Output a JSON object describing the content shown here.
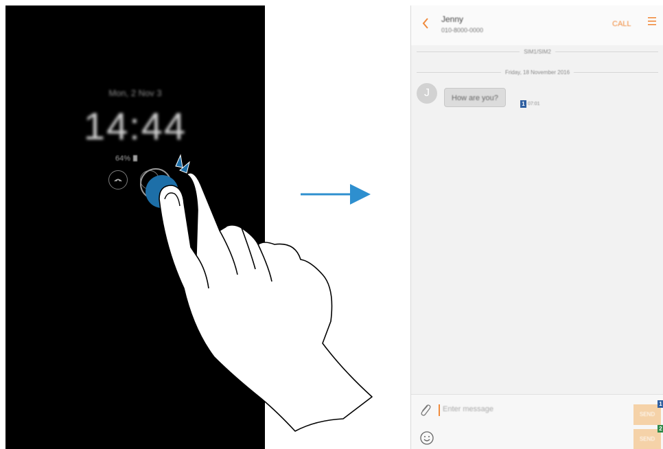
{
  "aod": {
    "date": "Mon, 2 Nov 3",
    "time": "14:44",
    "battery": "64%"
  },
  "messages": {
    "contact_name": "Jenny",
    "contact_number": "010-8000-0000",
    "call_label": "CALL",
    "sim_header": "SIM1/SIM2",
    "date_separator": "Friday, 18 November 2016",
    "avatar_letter": "J",
    "incoming": {
      "text": "How are you?",
      "sim": "1",
      "time": "07:01"
    },
    "input_placeholder": "Enter message",
    "send_buttons": [
      {
        "label": "SEND",
        "sim": "1"
      },
      {
        "label": "SEND",
        "sim": "2"
      }
    ]
  },
  "icons": {
    "back": "chevron-left",
    "menu": "hamburger",
    "attach": "paperclip",
    "emoji": "smiley",
    "aod_left": "missed-call",
    "aod_right": "message"
  },
  "colors": {
    "accent": "#f08a3c",
    "tap_blue": "#1d6fa8",
    "arrow_blue": "#2e8fcf",
    "sim1": "#2f5fa0",
    "sim2": "#2f8a4a"
  }
}
